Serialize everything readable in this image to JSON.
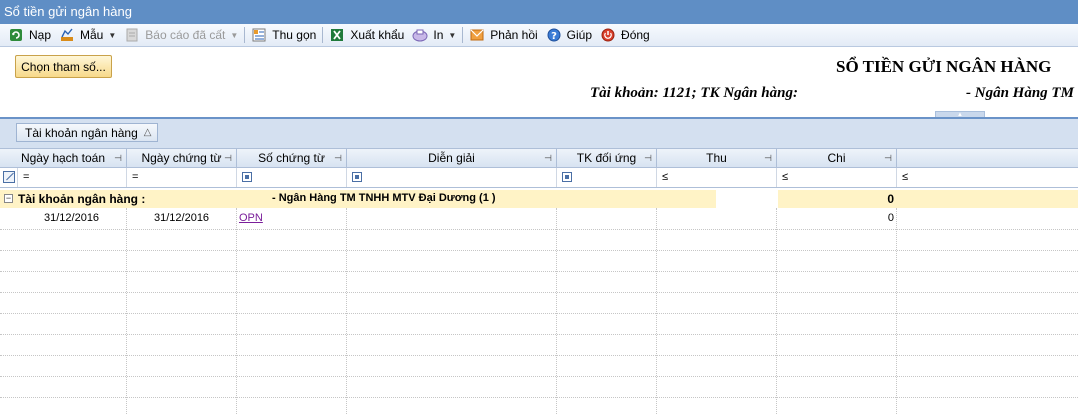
{
  "window": {
    "title": "Sổ tiền gửi ngân hàng"
  },
  "toolbar": {
    "items": [
      {
        "label": "Nạp",
        "icon": "refresh-icon"
      },
      {
        "label": "Mẫu",
        "icon": "template-icon",
        "has_dropdown": true
      },
      {
        "label": "Báo cáo đã cất",
        "icon": "saved-report-icon",
        "has_dropdown": true,
        "disabled": true
      },
      {
        "label": "Thu gọn",
        "icon": "collapse-icon"
      },
      {
        "label": "Xuất khẩu",
        "icon": "excel-export-icon"
      },
      {
        "label": "In",
        "icon": "print-icon",
        "has_dropdown": true
      },
      {
        "label": "Phản hồi",
        "icon": "feedback-icon"
      },
      {
        "label": "Giúp",
        "icon": "help-icon"
      },
      {
        "label": "Đóng",
        "icon": "close-icon"
      }
    ]
  },
  "params_button": {
    "label": "Chọn tham số..."
  },
  "report": {
    "title": "SỔ TIỀN GỬI NGÂN HÀNG",
    "subtitle_left": "Tài khoản: 1121; TK Ngân hàng:",
    "subtitle_right": "- Ngân Hàng TM"
  },
  "group_panel": {
    "chip_label": "Tài khoản ngân hàng"
  },
  "grid": {
    "columns": [
      "Ngày hạch toán",
      "Ngày chứng từ",
      "Số chứng từ",
      "Diễn giải",
      "TK đối ứng",
      "Thu",
      "Chi"
    ],
    "filter_ops": [
      "=",
      "=",
      "",
      "",
      "",
      "≤",
      "≤",
      "≤"
    ],
    "group": {
      "label": "Tài khoản ngân hàng :",
      "name": "- Ngân Hàng TM TNHH MTV Đại Dương (1 )",
      "total": "0"
    },
    "rows": [
      {
        "ngay_hach_toan": "31/12/2016",
        "ngay_chung_tu": "31/12/2016",
        "so_chung_tu": "OPN",
        "dien_giai": "",
        "tk_doi_ung": "",
        "thu": "",
        "chi": "0"
      }
    ]
  },
  "colors": {
    "titlebar": "#5f8ec5",
    "group_row": "#fff3c6",
    "link": "#7a1e9a"
  }
}
